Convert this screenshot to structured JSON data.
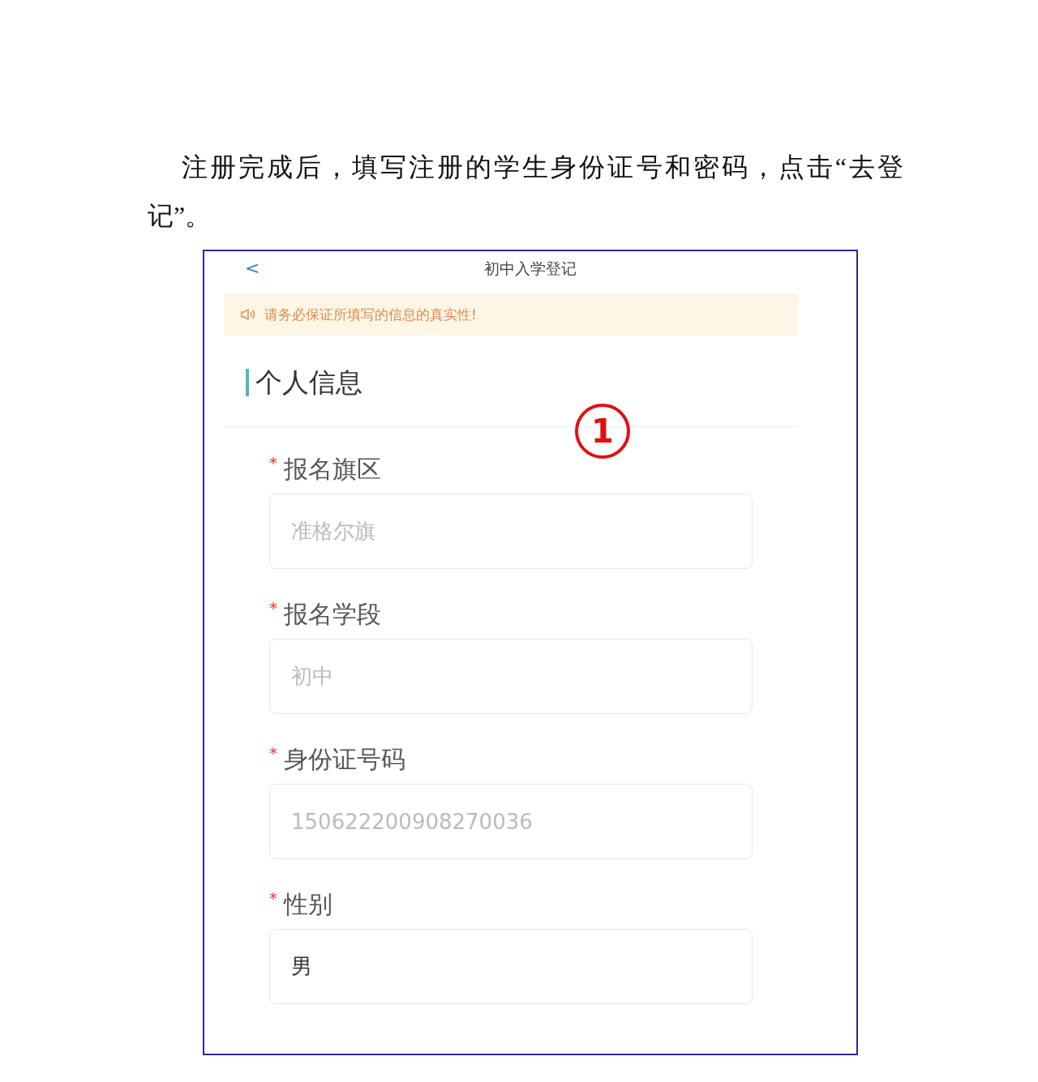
{
  "paragraph": "注册完成后，填写注册的学生身份证号和密码，点击“去登记”。",
  "screen": {
    "back": "<",
    "title": "初中入学登记",
    "notice": "请务必保证所填写的信息的真实性!",
    "section_title": "个人信息",
    "fields": [
      {
        "required_mark": "*",
        "label": "报名旗区",
        "value": "准格尔旗",
        "disabled": true
      },
      {
        "required_mark": "*",
        "label": "报名学段",
        "value": "初中",
        "disabled": true
      },
      {
        "required_mark": "*",
        "label": "身份证号码",
        "value": "150622200908270036",
        "disabled": true
      },
      {
        "required_mark": "*",
        "label": "性别",
        "value": "男",
        "disabled": false
      }
    ]
  },
  "annotation": "1"
}
